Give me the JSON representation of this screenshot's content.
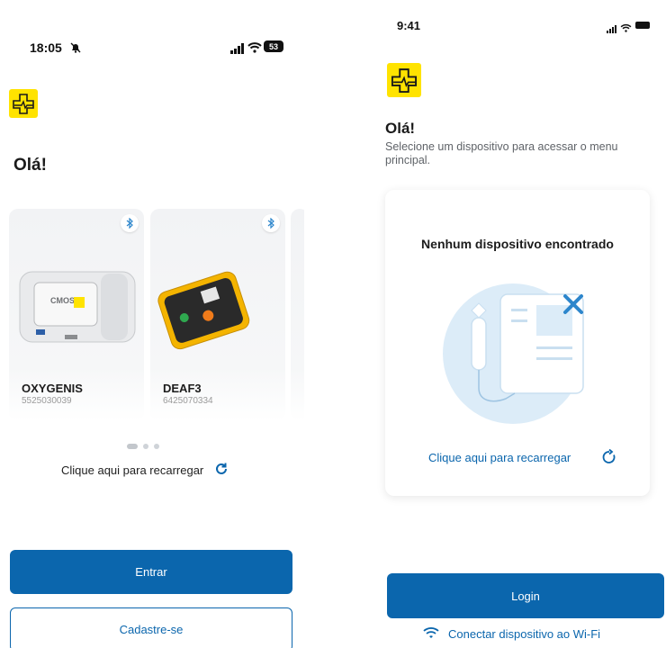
{
  "screen_left": {
    "status": {
      "time": "18:05",
      "battery": "53"
    },
    "greeting": "Olá!",
    "devices": [
      {
        "name": "OXYGENIS",
        "serial": "5525030039",
        "screen_text": "CMOS DRAKE"
      },
      {
        "name": "DEAF3",
        "serial": "6425070334"
      }
    ],
    "reload_label": "Clique aqui para recarregar",
    "primary_button": "Entrar",
    "secondary_button": "Cadastre-se"
  },
  "screen_right": {
    "status": {
      "time": "9:41"
    },
    "greeting": "Olá!",
    "subtitle": "Selecione um dispositivo para acessar o menu principal.",
    "empty_title": "Nenhum dispositivo encontrado",
    "reload_label": "Clique aqui para recarregar",
    "login_button": "Login",
    "wifi_link": "Conectar dispositivo ao Wi-Fi"
  },
  "colors": {
    "primary": "#0b66ad",
    "logo_yellow": "#ffe300",
    "illustration_bg": "#dcecf8",
    "accent_blue": "#2d86cc"
  },
  "icons": [
    "bell-slash-icon",
    "signal-icon",
    "wifi-icon",
    "battery-icon",
    "logo-icon",
    "bluetooth-icon",
    "reload-icon",
    "device-x-illustration"
  ]
}
